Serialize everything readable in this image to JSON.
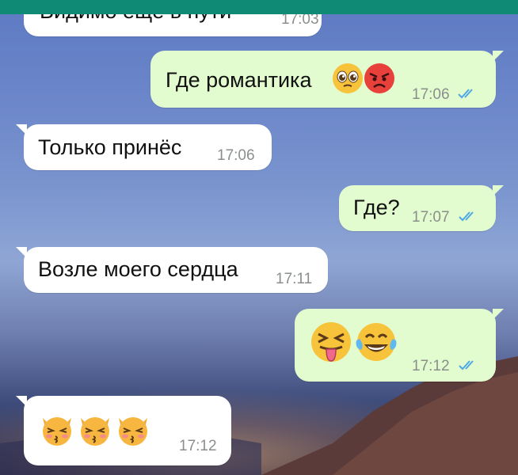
{
  "colors": {
    "header": "#0f8a75",
    "incoming_bubble": "#ffffff",
    "outgoing_bubble": "#e2fbcf",
    "time_text": "#8a8f8c",
    "read_ticks": "#4fa8e6"
  },
  "messages": [
    {
      "direction": "incoming",
      "text": "Видимо ещё в пути",
      "time": "17:03"
    },
    {
      "direction": "outgoing",
      "text": "Где романтика",
      "emoji": [
        "pleading-face-icon",
        "angry-face-icon"
      ],
      "time": "17:06",
      "status": "read"
    },
    {
      "direction": "incoming",
      "text": "Только принёс",
      "time": "17:06"
    },
    {
      "direction": "outgoing",
      "text": "Где?",
      "time": "17:07",
      "status": "read"
    },
    {
      "direction": "incoming",
      "text": "Возле моего сердца",
      "time": "17:11"
    },
    {
      "direction": "outgoing",
      "text": "",
      "emoji": [
        "squinting-tongue-face-icon",
        "tears-of-joy-face-icon"
      ],
      "time": "17:12",
      "status": "read"
    },
    {
      "direction": "incoming",
      "text": "",
      "emoji": [
        "kissing-cat-icon",
        "kissing-cat-icon",
        "kissing-cat-icon"
      ],
      "time": "17:12"
    }
  ]
}
